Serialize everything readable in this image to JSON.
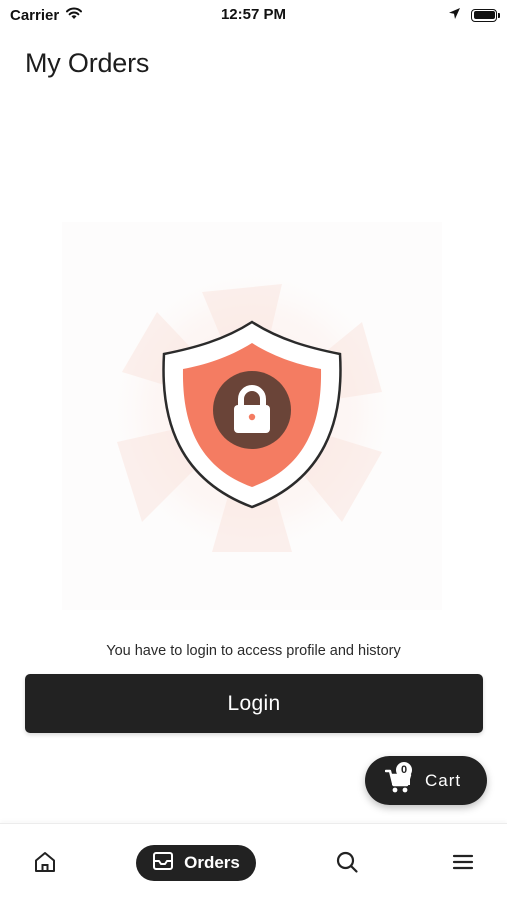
{
  "status_bar": {
    "carrier": "Carrier",
    "time": "12:57 PM"
  },
  "header": {
    "title": "My Orders"
  },
  "illustration": {
    "icon": "shield-lock-icon",
    "colors": {
      "shield_fill": "#f47c62",
      "lock_circle": "#6a4438",
      "outline": "#2b2b2b"
    }
  },
  "auth": {
    "message": "You have to login to access profile and history",
    "login_label": "Login"
  },
  "cart": {
    "count": "0",
    "label": "Cart"
  },
  "bottom_nav": {
    "items": [
      {
        "icon": "home-icon"
      },
      {
        "icon": "inbox-icon",
        "label": "Orders",
        "active": true
      },
      {
        "icon": "search-icon"
      },
      {
        "icon": "menu-icon"
      }
    ]
  },
  "colors": {
    "primary_dark": "#222222",
    "accent": "#f47c62"
  }
}
